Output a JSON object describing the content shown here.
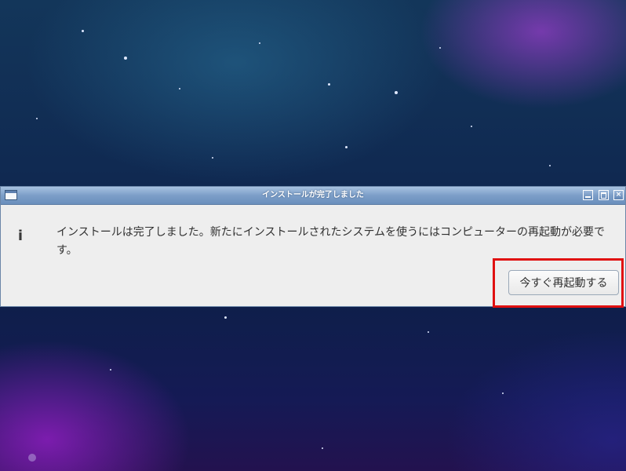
{
  "dialog": {
    "title": "インストールが完了しました",
    "info_icon_glyph": "i",
    "message": "インストールは完了しました。新たにインストールされたシステムを使うにはコンピューターの再起動が必要です。",
    "restart_button_label": "今すぐ再起動する"
  },
  "colors": {
    "titlebar": "#7c9ec8",
    "dialog_background": "#eeeeee",
    "highlight": "#e01010"
  },
  "icons": {
    "app": "window-icon",
    "info": "info-icon",
    "minimize": "minimize-icon",
    "maximize": "maximize-icon",
    "close": "close-icon"
  }
}
